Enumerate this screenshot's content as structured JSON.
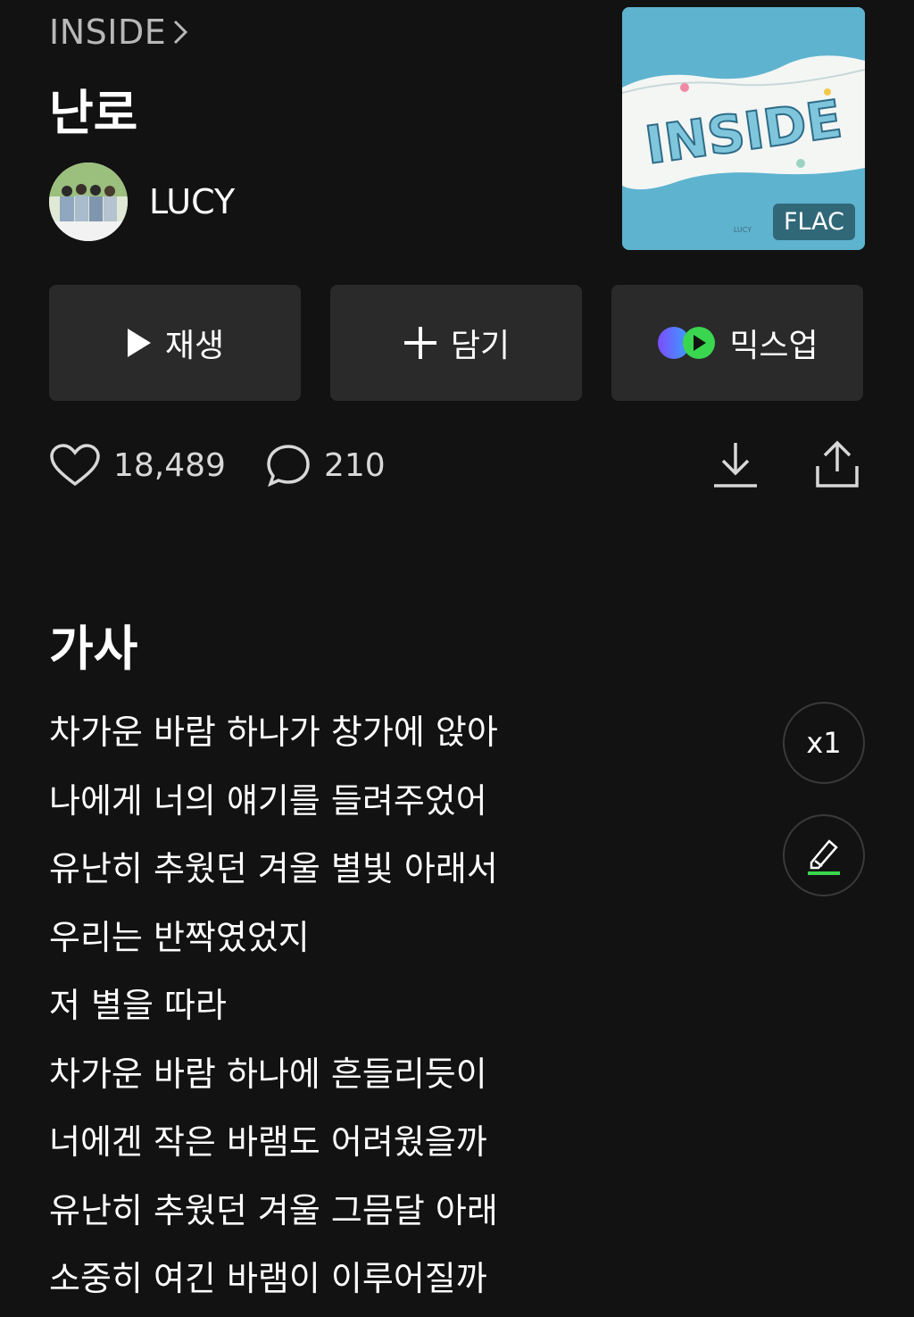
{
  "album": {
    "title": "INSIDE",
    "badge": "FLAC",
    "cover_text": "INSIDE",
    "cover_label": "LUCY"
  },
  "song": {
    "title": "난로"
  },
  "artist": {
    "name": "LUCY"
  },
  "actions": {
    "play_label": "재생",
    "add_label": "담기",
    "mixup_label": "믹스업"
  },
  "stats": {
    "likes": "18,489",
    "comments": "210"
  },
  "lyrics": {
    "heading": "가사",
    "speed_label": "x1",
    "lines": [
      "차가운 바람 하나가 창가에 앉아",
      "나에게 너의 얘기를 들려주었어",
      "유난히 추웠던 겨울 별빛 아래서",
      "우리는 반짝였었지",
      "저 별을 따라",
      "차가운 바람 하나에 흔들리듯이",
      "너에겐 작은 바램도 어려웠을까",
      "유난히 추웠던 겨울 그믐달 아래",
      "소중히 여긴 바램이 이루어질까"
    ]
  },
  "colors": {
    "background": "#121212",
    "button_bg": "#2a2a2a",
    "accent_green": "#3ad64f",
    "cover_blue": "#5eb3cf"
  },
  "icons": [
    "chevron-right-icon",
    "play-icon",
    "plus-icon",
    "mixup-icon",
    "heart-icon",
    "comment-icon",
    "download-icon",
    "share-icon",
    "highlighter-icon"
  ]
}
